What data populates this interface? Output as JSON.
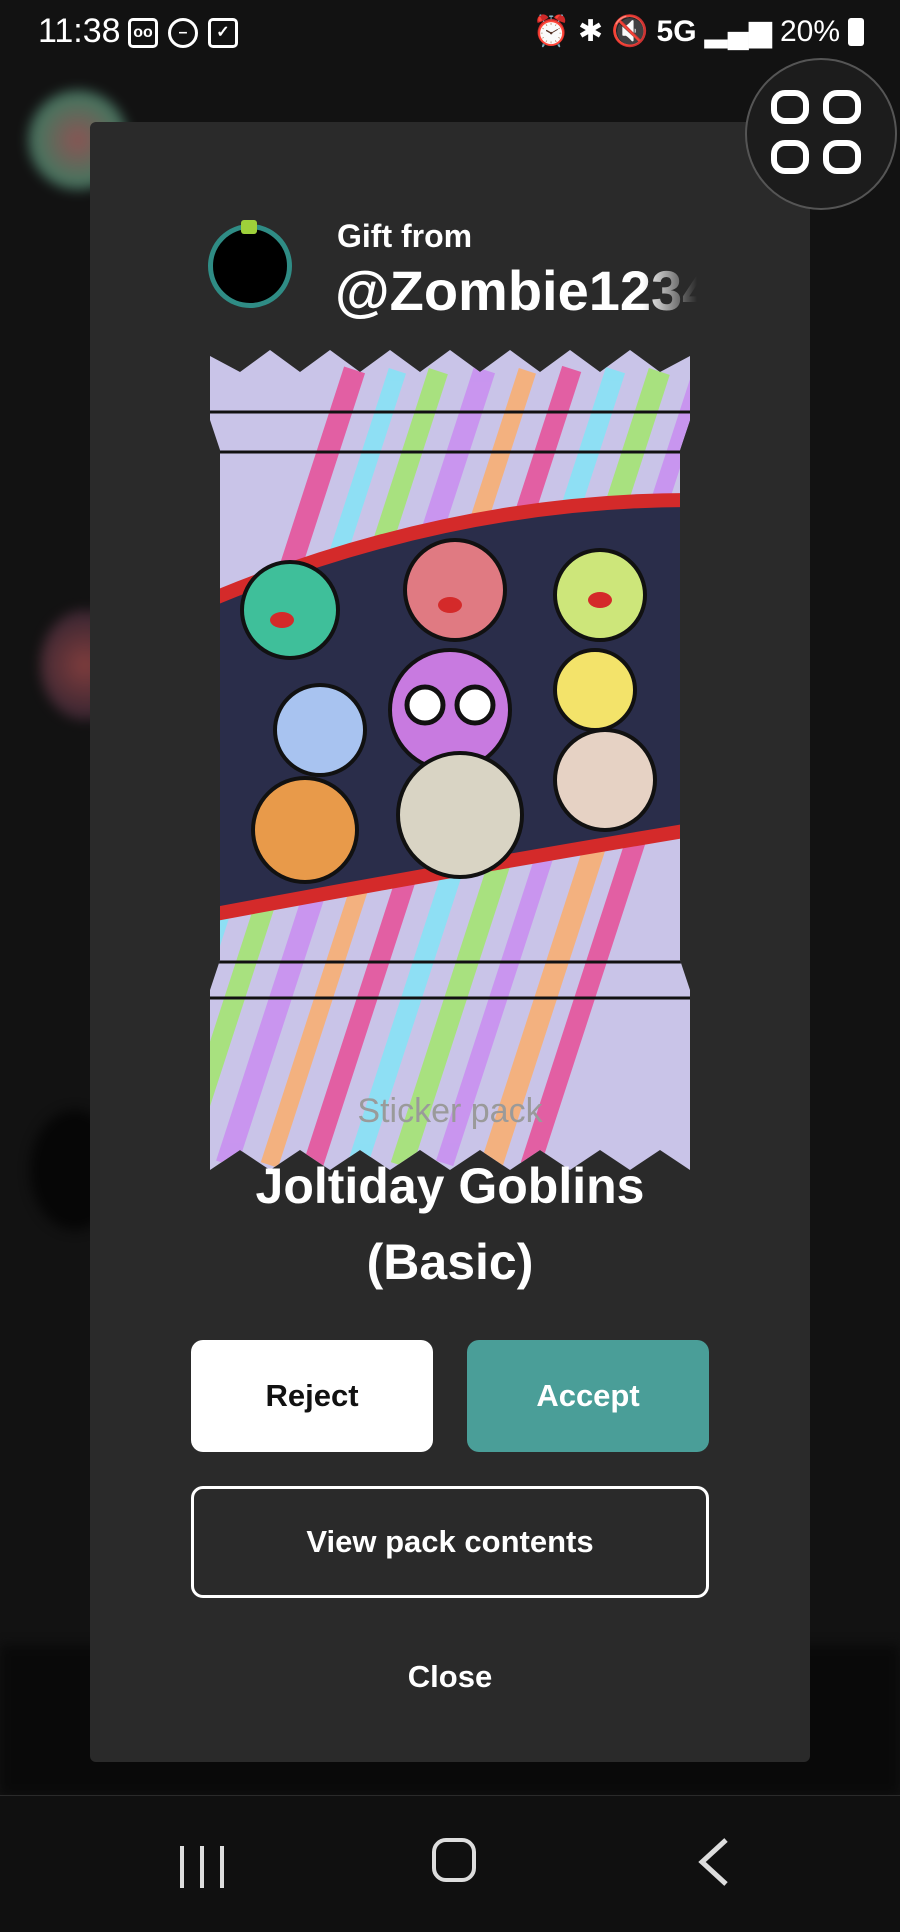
{
  "status_bar": {
    "time": "11:38",
    "left_icons": [
      "voicemail-icon",
      "do-not-disturb-icon",
      "checkbox-icon"
    ],
    "right_icons": [
      "alarm-icon",
      "bluetooth-icon",
      "mute-icon"
    ],
    "network": "5G",
    "battery": "20%"
  },
  "gift": {
    "label": "Gift from",
    "username": "@Zombie1234"
  },
  "pack": {
    "type": "Sticker pack",
    "name_line1": "Joltiday Goblins",
    "name_line2": "(Basic)"
  },
  "actions": {
    "reject": "Reject",
    "accept": "Accept",
    "view": "View pack contents",
    "close": "Close"
  },
  "colors": {
    "accent": "#4a9e98",
    "modal_bg": "#2a2a2a",
    "wrapper_red": "#d42a2a"
  }
}
